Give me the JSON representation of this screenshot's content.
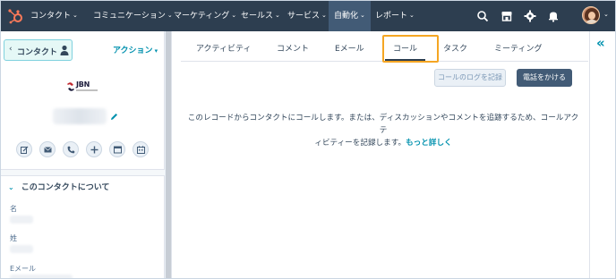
{
  "topnav": {
    "items": [
      {
        "label": "コンタクト"
      },
      {
        "label": "コミュニケーション"
      },
      {
        "label": "マーケティング"
      },
      {
        "label": "セールス"
      },
      {
        "label": "サービス"
      },
      {
        "label": "自動化"
      },
      {
        "label": "レポート"
      }
    ],
    "icons": [
      "search-icon",
      "marketplace-icon",
      "settings-icon",
      "notifications-icon"
    ]
  },
  "sidebar": {
    "back_label": "コンタクト",
    "actions_label": "アクション",
    "company_logo_text": "JBN",
    "about_title": "このコンタクトについて",
    "fields": [
      {
        "label": "名"
      },
      {
        "label": "姓"
      },
      {
        "label": "Eメール"
      }
    ],
    "quick_actions": [
      "note-icon",
      "email-icon",
      "call-icon",
      "add-icon",
      "task-icon",
      "meeting-icon"
    ]
  },
  "main": {
    "tabs": [
      {
        "label": "アクティビティ"
      },
      {
        "label": "コメント"
      },
      {
        "label": "Eメール"
      },
      {
        "label": "コール"
      },
      {
        "label": "タスク"
      },
      {
        "label": "ミーティング"
      }
    ],
    "active_tab": "コール",
    "log_call_button": "コールのログを記録",
    "make_call_button": "電話をかける",
    "empty_text_line1": "このレコードからコンタクトにコールします。または、ディスカッションやコメントを追跡するため、コールアクテ",
    "empty_text_line2": "ィビティーを記録します。",
    "learn_more": "もっと詳しく"
  },
  "colors": {
    "nav_bg": "#2d3e50",
    "accent": "#0091ae",
    "highlight": "#f5a623",
    "primary_button": "#425b76"
  }
}
